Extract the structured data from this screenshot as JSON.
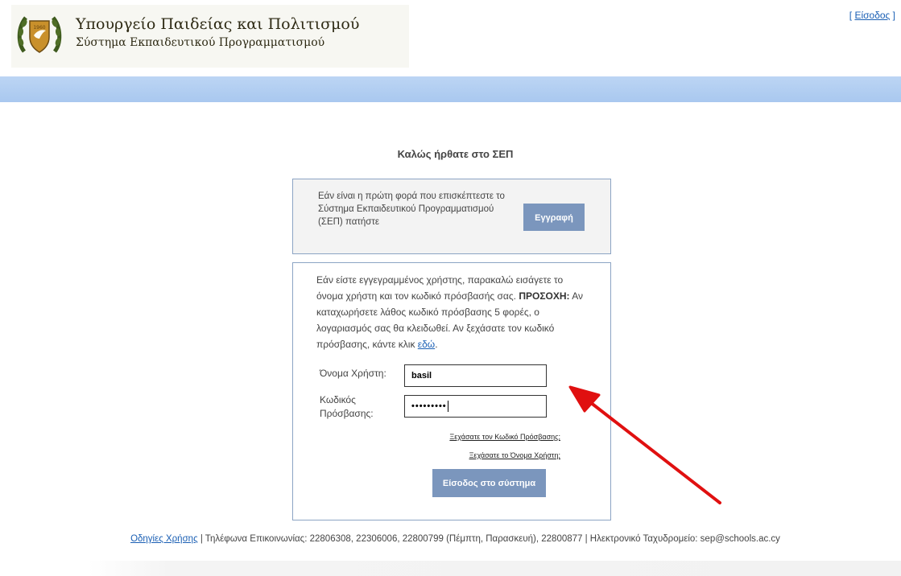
{
  "header": {
    "ministry_title": "Υπουργείο Παιδείας και Πολιτισμού",
    "ministry_subtitle": "Σύστημα Εκπαιδευτικού Προγραμματισμού",
    "login_link_text": "Είσοδος",
    "login_link_prefix": "[ ",
    "login_link_suffix": " ]"
  },
  "main": {
    "welcome_title": "Καλώς ήρθατε στο ΣΕΠ",
    "register": {
      "text": "Εάν είναι η πρώτη φορά που επισκέπτεστε το Σύστημα Εκπαιδευτικού Προγραμματισμού (ΣΕΠ) πατήστε",
      "button_label": "Εγγραφή"
    },
    "login": {
      "info_text": "Εάν είστε εγγεγραμμένος χρήστης, παρακαλώ εισάγετε το όνομα χρήστη και τον κωδικό πρόσβασής σας.",
      "warning_label": "ΠΡΟΣΟΧΗ:",
      "warning_text": " Αν καταχωρήσετε λάθος κωδικό πρόσβασης 5 φορές, ο λογαριασμός σας θα κλειδωθεί. Αν ξεχάσατε τον κωδικό πρόσβασης, κάντε κλικ ",
      "here_link": "εδώ",
      "period": ".",
      "username_label": "Όνομα Χρήστη:",
      "username_value": "basil",
      "password_label": "Κωδικός Πρόσβασης:",
      "password_value": "•••••••••",
      "forgot_password": "Ξεχάσατε τον Κωδικό Πρόσβασης;",
      "forgot_username": "Ξεχάσατε το Όνομα Χρήστη;",
      "submit_label": "Είσοδος στο σύστημα"
    }
  },
  "footer": {
    "guide_link": "Οδηγίες Χρήσης",
    "contact_text": " | Τηλέφωνα Επικοινωνίας: 22806308, 22306006, 22800799 (Πέμπτη, Παρασκευή), 22800877 | Ηλεκτρονικό Ταχυδρομείο: sep@schools.ac.cy"
  },
  "colors": {
    "accent_band": "#a9c8ef",
    "button": "#7b96bd",
    "link": "#1a5fb4",
    "annotation_arrow": "#e01010"
  },
  "icons": {
    "emblem": "cyprus-coat-of-arms-icon",
    "arrow": "annotation-arrow-icon"
  }
}
